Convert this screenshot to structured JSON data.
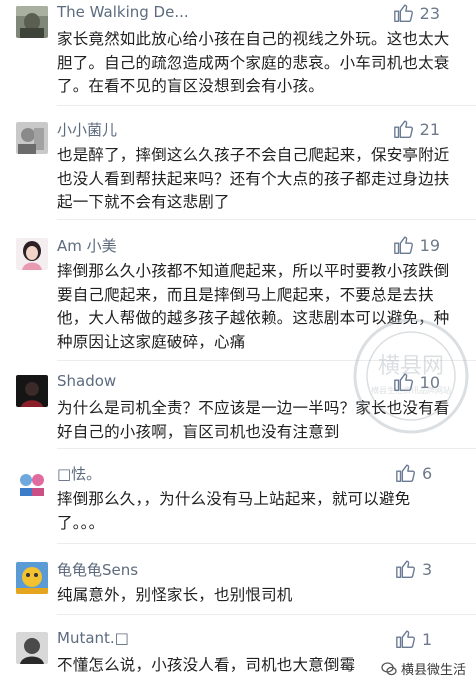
{
  "comments": [
    {
      "username": "The Walking De...",
      "likes": "23",
      "avatar": "zombie-avatar",
      "text": "家长竟然如此放心给小孩在自己的视线之外玩。这也太大胆了。自己的疏忽造成两个家庭的悲哀。小车司机也太衰了。在看不见的盲区没想到会有小孩。"
    },
    {
      "username": "小小菌儿",
      "likes": "21",
      "avatar": "grey-photo-avatar",
      "text": "也是醉了，摔倒这么久孩子不会自己爬起来，保安亭附近也没人看到帮扶起来吗？还有个大点的孩子都走过身边扶起一下就不会有这悲剧了"
    },
    {
      "username": "Am 小美",
      "likes": "19",
      "avatar": "girl-avatar",
      "text": "摔倒那么久小孩都不知道爬起来，所以平时要教小孩跌倒要自己爬起来，而且是摔倒马上爬起来，不要总是去扶他，大人帮做的越多孩子越依赖。这悲剧本可以避免，种种原因让这家庭破碎，心痛"
    },
    {
      "username": "Shadow",
      "likes": "10",
      "avatar": "dark-avatar",
      "text": "为什么是司机全责？不应该是一边一半吗？家长也没有看好自己的小孩啊，盲区司机也没有注意到"
    },
    {
      "username": "□怯。",
      "likes": "6",
      "avatar": "cartoon-avatar",
      "text": "摔倒那么久，，为什么没有马上站起来，就可以避免了。。。"
    },
    {
      "username": "龟龟龟Sens",
      "likes": "3",
      "avatar": "yellow-avatar",
      "text": "纯属意外，别怪家长，也别恨司机"
    },
    {
      "username": "Mutant.□",
      "likes": "1",
      "avatar": "bw-avatar",
      "text": "不懂怎么说，小孩没人看，司机也大意倒霉"
    }
  ],
  "watermark": {
    "main": "横县网",
    "sub": "横县生活资讯品牌网站"
  },
  "brand": {
    "label": "横县微生活"
  },
  "colors": {
    "username": "#5d6b7f",
    "text": "#202020",
    "like_icon": "#6a7a92"
  }
}
